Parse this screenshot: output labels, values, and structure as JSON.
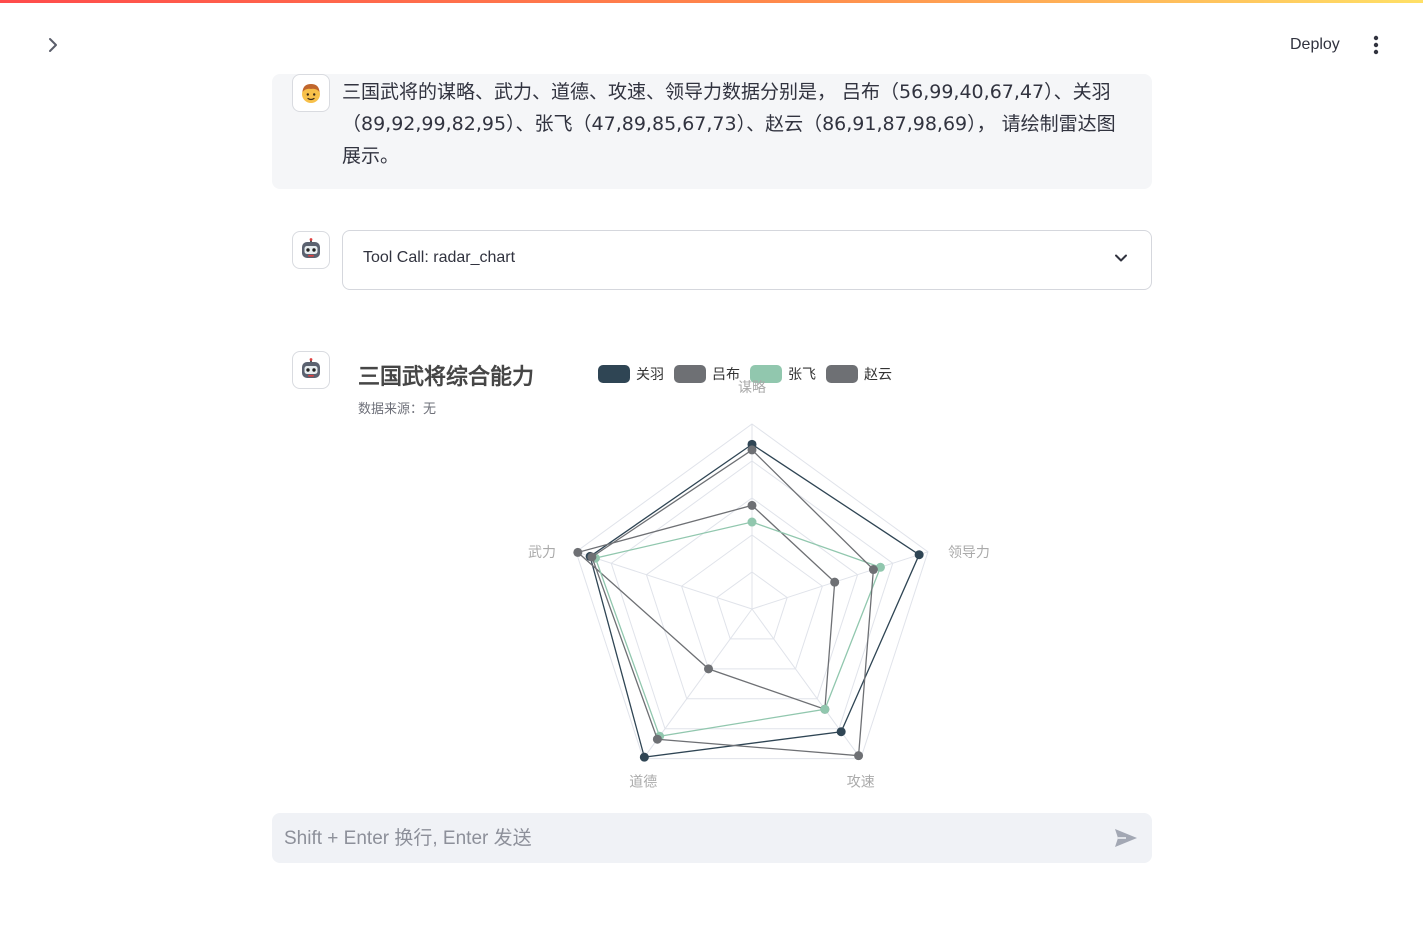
{
  "header": {
    "deploy_label": "Deploy",
    "sidebar_icon": "chevron-right-icon",
    "menu_icon": "kebab-menu-icon"
  },
  "user_message": {
    "avatar_icon": "user-avatar-icon",
    "text": "三国武将的谋略、武力、道德、攻速、领导力数据分别是， 吕布（56,99,40,67,47）、关羽（89,92,99,82,95）、张飞（47,89,85,67,73）、赵云（86,91,87,98,69）， 请绘制雷达图展示。"
  },
  "tool_call": {
    "avatar_icon": "robot-avatar-icon",
    "label": "Tool Call: radar_chart",
    "expand_icon": "chevron-down-icon"
  },
  "chart_message": {
    "avatar_icon": "robot-avatar-icon"
  },
  "chart_data": {
    "type": "radar",
    "title": "三国武将综合能力",
    "subtitle": "数据来源：无",
    "indicators": [
      "谋略",
      "领导力",
      "攻速",
      "道德",
      "武力"
    ],
    "max": 100,
    "series": [
      {
        "name": "关羽",
        "color": "#2f4554",
        "values": [
          89,
          95,
          82,
          99,
          92
        ]
      },
      {
        "name": "吕布",
        "color": "#6e7074",
        "values": [
          56,
          47,
          67,
          40,
          99
        ]
      },
      {
        "name": "张飞",
        "color": "#91c7ae",
        "values": [
          47,
          73,
          67,
          85,
          89
        ]
      },
      {
        "name": "赵云",
        "color": "#6e7074",
        "values": [
          86,
          69,
          98,
          87,
          91
        ]
      }
    ]
  },
  "input": {
    "placeholder": "Shift + Enter 换行, Enter 发送",
    "send_icon": "send-icon"
  }
}
